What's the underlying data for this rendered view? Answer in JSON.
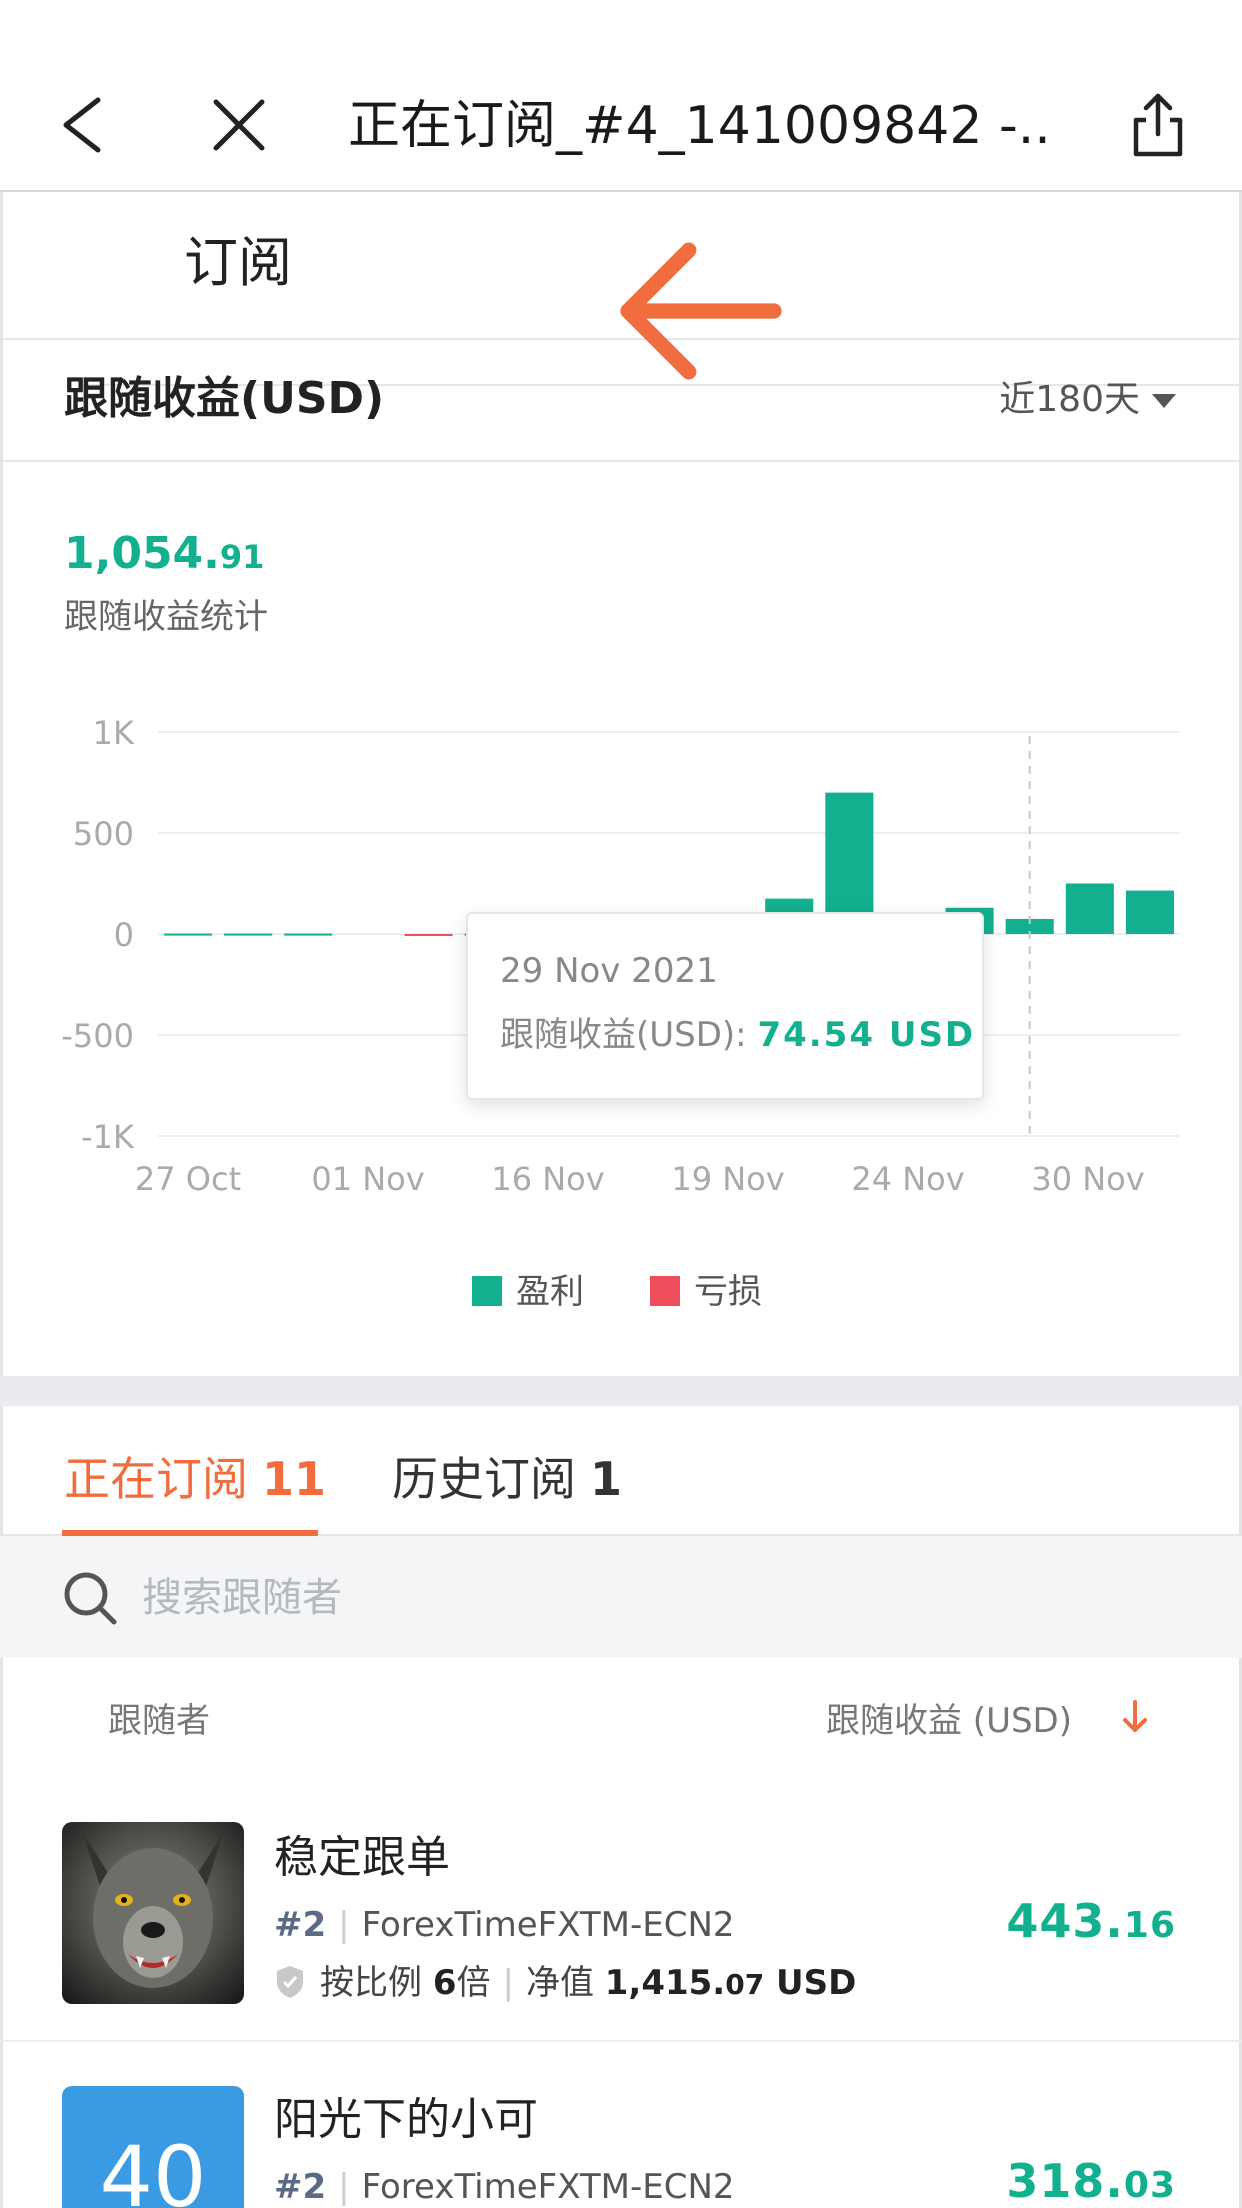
{
  "nav": {
    "title": "正在订阅_#4_141009842 -..."
  },
  "subheader": {
    "title": "订阅"
  },
  "section": {
    "title": "跟随收益(USD)",
    "range": "近180天"
  },
  "summary": {
    "total_int": "1,054.",
    "total_dec": "91",
    "label": "跟随收益统计"
  },
  "chart_data": {
    "type": "bar",
    "categories": [
      "27 Oct",
      "01 Nov",
      "16 Nov",
      "19 Nov",
      "24 Nov",
      "30 Nov"
    ],
    "y_ticks": [
      "1K",
      "500",
      "0",
      "-500",
      "-1K"
    ],
    "ylim": [
      -1000,
      1000
    ],
    "series": [
      {
        "name": "盈利",
        "color": "#12b08e",
        "values": [
          2,
          2,
          2,
          0,
          0,
          2,
          2,
          0,
          0,
          0,
          175,
          700,
          0,
          130,
          74.54,
          250,
          215
        ]
      },
      {
        "name": "亏损",
        "color": "#ee4e5b",
        "values": [
          0,
          0,
          0,
          0,
          -2,
          0,
          0,
          0,
          0,
          0,
          0,
          0,
          0,
          0,
          0,
          0,
          0
        ]
      }
    ],
    "tooltip": {
      "date": "29 Nov 2021",
      "label": "跟随收益(USD):",
      "value": "74.54 USD"
    },
    "legend": [
      "盈利",
      "亏损"
    ]
  },
  "tabs": [
    {
      "label": "正在订阅",
      "count": "11"
    },
    {
      "label": "历史订阅",
      "count": "1"
    }
  ],
  "search": {
    "placeholder": "搜索跟随者"
  },
  "list": {
    "col_left": "跟随者",
    "col_right": "跟随收益 (USD)",
    "items": [
      {
        "name": "稳定跟单",
        "rank": "#2",
        "server": "ForexTimeFXTM-ECN2",
        "mode_prefix": "按比例",
        "multiplier": "6",
        "mode_suffix": "倍",
        "equity_label": "净值",
        "equity_int": "1,415.",
        "equity_dec": "07",
        "equity_unit": "USD",
        "profit_int": "443.",
        "profit_dec": "16"
      },
      {
        "name": "阳光下的小可",
        "rank": "#2",
        "server": "ForexTimeFXTM-ECN2",
        "avatar_text": "40",
        "profit_int": "318.",
        "profit_dec": "03"
      }
    ]
  }
}
